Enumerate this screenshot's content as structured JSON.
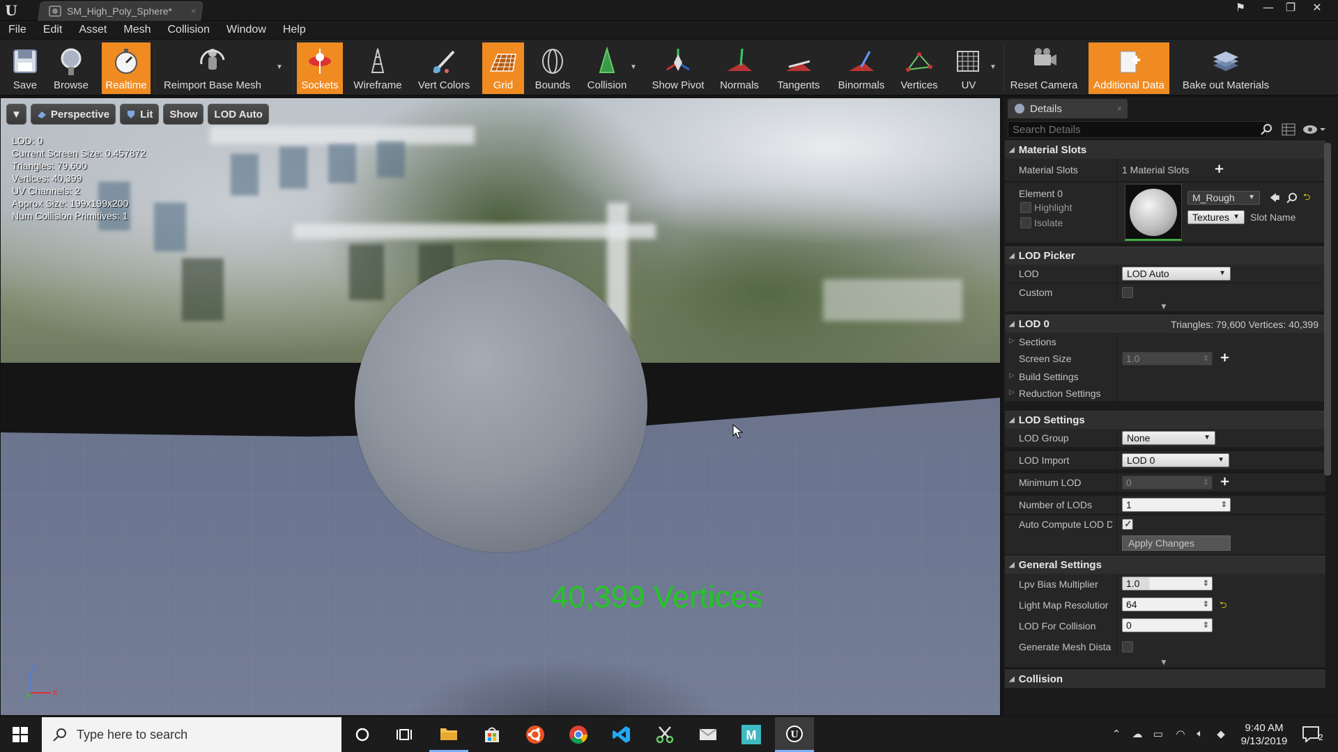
{
  "window": {
    "tab_title": "SM_High_Poly_Sphere*",
    "tab_close": "×",
    "min": "—",
    "max": "❐",
    "close": "✕"
  },
  "menu": [
    "File",
    "Edit",
    "Asset",
    "Mesh",
    "Collision",
    "Window",
    "Help"
  ],
  "toolbar": {
    "save": "Save",
    "browse": "Browse",
    "realtime": "Realtime",
    "reimport": "Reimport Base Mesh",
    "sockets": "Sockets",
    "wireframe": "Wireframe",
    "vert_colors": "Vert Colors",
    "grid": "Grid",
    "bounds": "Bounds",
    "collision": "Collision",
    "show_pivot": "Show Pivot",
    "normals": "Normals",
    "tangents": "Tangents",
    "binormals": "Binormals",
    "vertices": "Vertices",
    "uv": "UV",
    "reset_camera": "Reset Camera",
    "additional_data": "Additional Data",
    "bake_out": "Bake out Materials",
    "active_color": "#f08b22"
  },
  "viewport": {
    "perspective": "Perspective",
    "lit": "Lit",
    "show": "Show",
    "lod_auto": "LOD Auto",
    "stats": [
      "LOD:  0",
      "Current Screen Size:  0.457872",
      "Triangles:  79,600",
      "Vertices:  40,399",
      "UV Channels:  2",
      "Approx Size: 199x199x200",
      "Num Collision Primitives:  1"
    ],
    "overlay": "40,399 Vertices",
    "overlay_color": "#22c722",
    "axis_z": "Z",
    "axis_x": "X"
  },
  "details": {
    "tab": "Details",
    "tab_close": "×",
    "search_placeholder": "Search Details",
    "material_slots": {
      "header": "Material Slots",
      "label": "Material Slots",
      "count": "1 Material Slots",
      "element": "Element 0",
      "highlight": "Highlight",
      "isolate": "Isolate",
      "material": "M_Rough",
      "textures": "Textures",
      "slot_name": "Slot Name"
    },
    "lod_picker": {
      "header": "LOD Picker",
      "lod_label": "LOD",
      "lod_value": "LOD Auto",
      "custom_label": "Custom"
    },
    "lod0": {
      "header": "LOD 0",
      "summary": "Triangles: 79,600   Vertices: 40,399",
      "sections": "Sections",
      "screen_size_label": "Screen Size",
      "screen_size_value": "1.0",
      "build_settings": "Build Settings",
      "reduction_settings": "Reduction Settings"
    },
    "lod_settings": {
      "header": "LOD Settings",
      "lod_group_label": "LOD Group",
      "lod_group_value": "None",
      "lod_import_label": "LOD Import",
      "lod_import_value": "LOD 0",
      "min_lod_label": "Minimum LOD",
      "min_lod_value": "0",
      "num_lods_label": "Number of LODs",
      "num_lods_value": "1",
      "auto_compute_label": "Auto Compute LOD D",
      "apply_changes": "Apply Changes"
    },
    "general_settings": {
      "header": "General Settings",
      "lpv_label": "Lpv Bias Multiplier",
      "lpv_value": "1.0",
      "lightmap_label": "Light Map Resolutior",
      "lightmap_value": "64",
      "lod_collision_label": "LOD For Collision",
      "lod_collision_value": "0",
      "gen_mesh_dist_label": "Generate Mesh Dista"
    },
    "collision_header": "Collision"
  },
  "taskbar": {
    "search_placeholder": "Type here to search",
    "time": "9:40 AM",
    "date": "9/13/2019",
    "notif_count": "2"
  }
}
